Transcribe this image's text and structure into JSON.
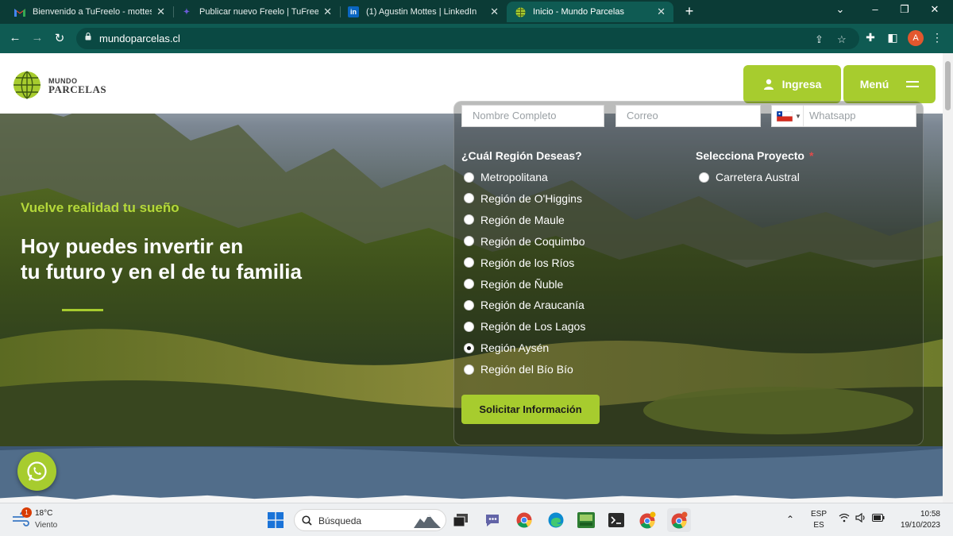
{
  "browser": {
    "tabs": [
      {
        "title": "Bienvenido a TuFreelo - mottes",
        "icon": "gmail-icon",
        "active": false
      },
      {
        "title": "Publicar nuevo Freelo | TuFreelo",
        "icon": "tufreelo-icon",
        "active": false
      },
      {
        "title": "(1) Agustin Mottes | LinkedIn",
        "icon": "linkedin-icon",
        "active": false
      },
      {
        "title": "Inicio - Mundo Parcelas",
        "icon": "mundoparcelas-icon",
        "active": true
      }
    ],
    "url": "mundoparcelas.cl",
    "profile_initial": "A"
  },
  "site": {
    "logo_line1": "MUNDO",
    "logo_line2": "PARCELAS",
    "login_label": "Ingresa",
    "menu_label": "Menú",
    "accent_color": "#a7cc2e"
  },
  "hero": {
    "tagline": "Vuelve realidad tu sueño",
    "headline": "Hoy puedes invertir en\ntu futuro y en el de tu familia"
  },
  "form": {
    "name_placeholder": "Nombre Completo",
    "email_placeholder": "Correo",
    "phone_placeholder": "Whatsapp",
    "region_title": "¿Cuál Región Deseas?",
    "regions": [
      {
        "label": "Metropolitana",
        "checked": false
      },
      {
        "label": "Región de O'Higgins",
        "checked": false
      },
      {
        "label": "Región de Maule",
        "checked": false
      },
      {
        "label": "Región de Coquimbo",
        "checked": false
      },
      {
        "label": "Región de los Ríos",
        "checked": false
      },
      {
        "label": "Región de Ñuble",
        "checked": false
      },
      {
        "label": "Región de Araucanía",
        "checked": false
      },
      {
        "label": "Región de Los Lagos",
        "checked": false
      },
      {
        "label": "Región Aysén",
        "checked": true
      },
      {
        "label": "Región del Bío Bío",
        "checked": false
      }
    ],
    "project_title": "Selecciona Proyecto",
    "required_mark": "*",
    "projects": [
      {
        "label": "Carretera Austral",
        "checked": false
      }
    ],
    "submit_label": "Solicitar Información"
  },
  "taskbar": {
    "weather_temp": "18°C",
    "weather_condition": "Viento",
    "weather_badge": "1",
    "search_label": "Búsqueda",
    "lang_top": "ESP",
    "lang_bottom": "ES",
    "time": "10:58",
    "date": "19/10/2023"
  }
}
